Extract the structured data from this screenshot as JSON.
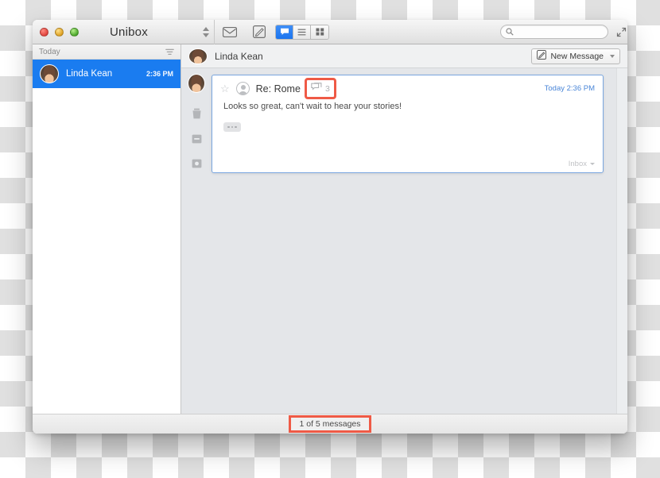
{
  "window": {
    "title": "Unibox",
    "traffic_lights": [
      "close-red",
      "minimize-yellow",
      "zoom-green"
    ]
  },
  "toolbar": {
    "mailbox_icon": "envelope-icon",
    "compose_icon": "compose-icon",
    "view_modes": [
      {
        "name": "conversation-view",
        "icon": "speech-bubble-icon",
        "active": true
      },
      {
        "name": "list-view",
        "icon": "list-lines-icon",
        "active": false
      },
      {
        "name": "grid-view",
        "icon": "grid-squares-icon",
        "active": false
      }
    ],
    "search": {
      "placeholder": "",
      "value": "",
      "icon": "search-icon"
    },
    "expand_icon": "fullscreen-expand-icon"
  },
  "sidebar": {
    "section_header": "Today",
    "filter_icon": "filter-icon",
    "conversations": [
      {
        "name": "Linda Kean",
        "time": "2:36 PM",
        "selected": true,
        "avatar": "contact-photo"
      }
    ]
  },
  "message_pane": {
    "header": {
      "sender": "Linda Kean",
      "avatar": "contact-photo"
    },
    "new_message_button": {
      "label": "New Message",
      "icon": "compose-icon",
      "dropdown_icon": "chevron-down-icon"
    },
    "action_rail": [
      {
        "name": "sender-avatar",
        "icon": "contact-photo"
      },
      {
        "name": "delete-action",
        "icon": "trash-icon"
      },
      {
        "name": "archive-action",
        "icon": "archive-icon"
      },
      {
        "name": "snooze-action",
        "icon": "box-icon"
      }
    ],
    "card": {
      "star_icon": "star-outline-icon",
      "avatar_icon": "generic-contact-icon",
      "subject": "Re: Rome",
      "thread_badge": {
        "icon": "stacked-bubbles-icon",
        "count": "3",
        "highlighted": true
      },
      "date": "Today 2:36 PM",
      "body_text": "Looks so great, can't wait to hear your stories!",
      "expand_button_icon": "ellipsis-icon",
      "mailbox_label": "Inbox",
      "mailbox_caret_icon": "chevron-down-icon"
    }
  },
  "statusbar": {
    "message_count": "1 of 5 messages",
    "highlighted": true
  },
  "colors": {
    "selection_blue": "#1a7cf0",
    "highlight_red": "#ef5a46",
    "date_blue": "#4a86d8",
    "card_border_blue": "#7aa7e0",
    "pane_background": "#e4e6e9"
  }
}
